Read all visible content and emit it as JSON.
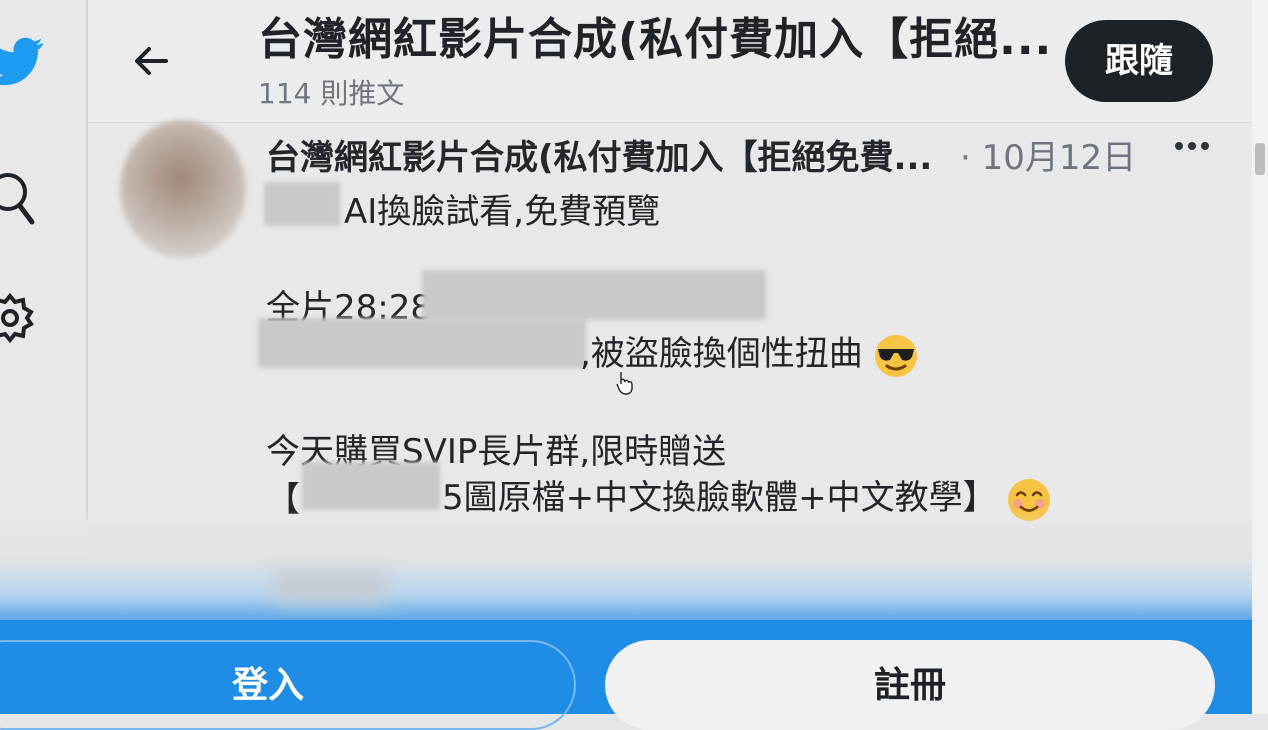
{
  "header": {
    "title": "台灣網紅影片合成(私付費加入【拒絕...",
    "post_count": "114 則推文",
    "follow_label": "跟隨"
  },
  "tweet": {
    "author": "台灣網紅影片合成(私付費加入【拒絕免費...",
    "date": "· 10月12日",
    "line1": "AI換臉試看,免費預覽",
    "line2": "全片28:28",
    "line3": ",被盜臉換個性扭曲",
    "line4": "今天購買SVIP長片群,限時贈送",
    "line5_prefix": "【",
    "line5_suffix": "5圖原檔+中文換臉軟體+中文教學】"
  },
  "footer": {
    "login_label": "登入",
    "signup_label": "註冊"
  },
  "icons": [
    "twitter-bird-icon",
    "search-icon",
    "gear-icon",
    "back-arrow-icon",
    "more-icon",
    "sunglasses-emoji-icon",
    "smiling-emoji-icon",
    "hand-cursor-icon"
  ],
  "colors": {
    "brand_blue": "#1f8de6",
    "bird_blue": "#1d9bf0",
    "follow_bg": "#1d2227"
  }
}
